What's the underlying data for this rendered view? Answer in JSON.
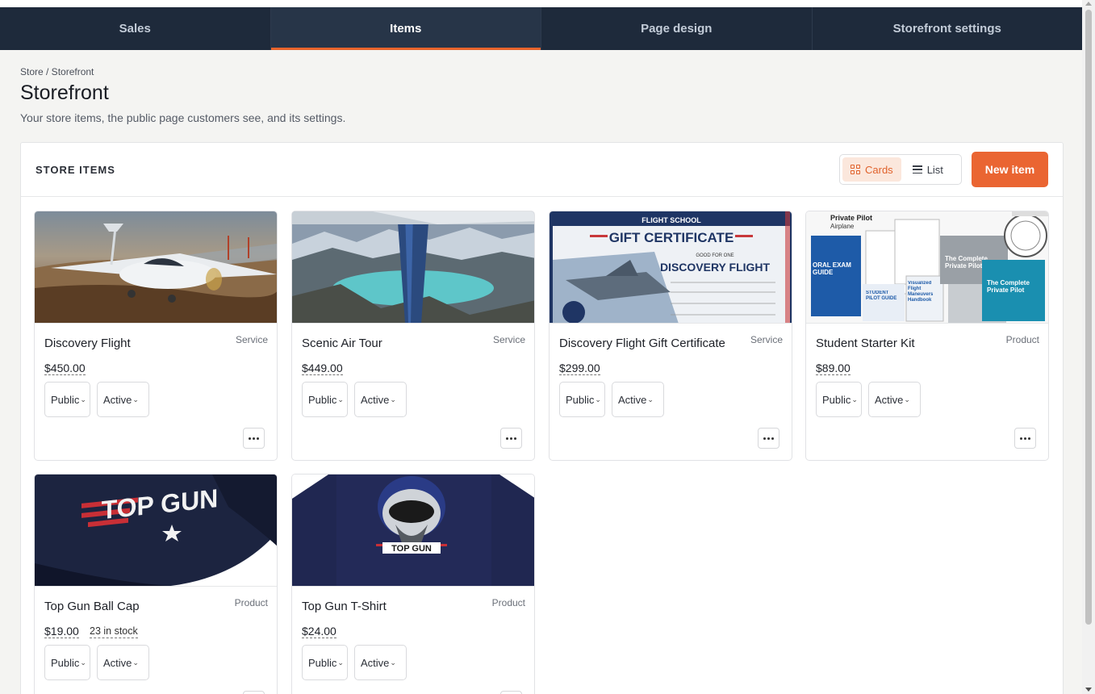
{
  "nav": {
    "tabs": [
      {
        "label": "Sales"
      },
      {
        "label": "Items"
      },
      {
        "label": "Page design"
      },
      {
        "label": "Storefront settings"
      }
    ],
    "active_tab": "Items"
  },
  "header": {
    "breadcrumb": "Store / Storefront",
    "title": "Storefront",
    "subtitle": "Your store items, the public page customers see, and its settings."
  },
  "panel": {
    "title": "STORE ITEMS",
    "view_cards_label": "Cards",
    "view_list_label": "List",
    "new_item_label": "New item"
  },
  "items": [
    {
      "name": "Discovery Flight",
      "type": "Service",
      "price": "$450.00",
      "visibility": "Public",
      "status": "Active"
    },
    {
      "name": "Scenic Air Tour",
      "type": "Service",
      "price": "$449.00",
      "visibility": "Public",
      "status": "Active"
    },
    {
      "name": "Discovery Flight Gift Certificate",
      "type": "Service",
      "price": "$299.00",
      "visibility": "Public",
      "status": "Active"
    },
    {
      "name": "Student Starter Kit",
      "type": "Product",
      "price": "$89.00",
      "visibility": "Public",
      "status": "Active"
    },
    {
      "name": "Top Gun Ball Cap",
      "type": "Product",
      "price": "$19.00",
      "stock": "23 in stock",
      "visibility": "Public",
      "status": "Active"
    },
    {
      "name": "Top Gun T-Shirt",
      "type": "Product",
      "price": "$24.00",
      "visibility": "Public",
      "status": "Active"
    }
  ],
  "images": {
    "gift_banner": "FLIGHT SCHOOL",
    "gift_title": "GIFT CERTIFICATE",
    "gift_sub": "GOOD FOR ONE",
    "gift_flight": "DISCOVERY FLIGHT",
    "kit_header": "Private Pilot",
    "kit_airplane": "Airplane",
    "kit_oral": "ORAL EXAM GUIDE",
    "kit_complete": "The Complete Private Pilot",
    "kit_complete2": "The Complete Private Pilot",
    "kit_guide": "STUDENT PILOT GUIDE",
    "kit_maneuvers": "Visualized Flight Maneuvers Handbook",
    "cap_logo": "TOP GUN",
    "shirt_logo": "TOP GUN"
  },
  "colors": {
    "nav_bg": "#1e2a3b",
    "accent": "#ea6532",
    "page_bg": "#f4f4f2"
  }
}
